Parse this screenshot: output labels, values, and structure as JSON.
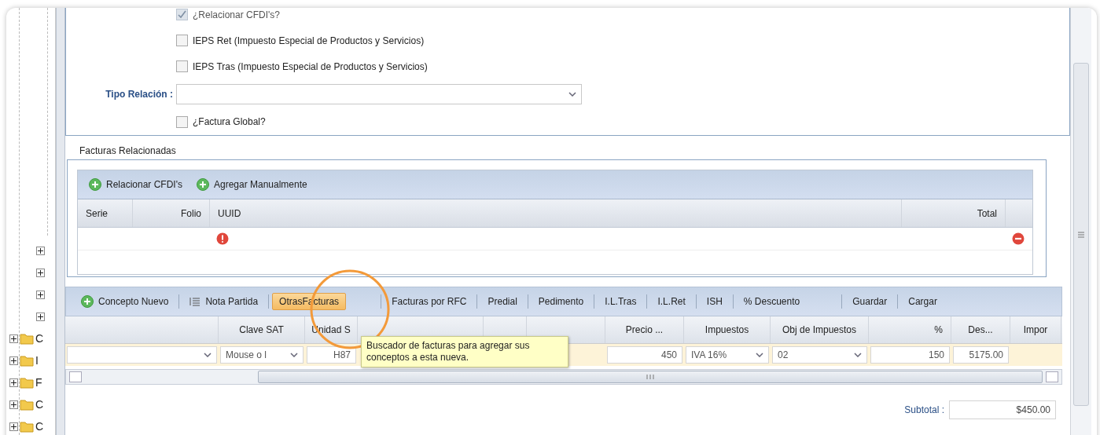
{
  "tree": {
    "items": [
      {
        "expanded": false
      },
      {
        "expanded": false
      },
      {
        "expanded": false
      },
      {
        "expanded": false
      },
      {
        "expanded": false,
        "label": "C"
      },
      {
        "expanded": false,
        "label": "I"
      },
      {
        "expanded": false,
        "label": "F"
      },
      {
        "expanded": false,
        "label": "C"
      },
      {
        "expanded": false,
        "label": "C"
      }
    ]
  },
  "form": {
    "checkboxes": [
      {
        "label": "¿Relacionar CFDI's?",
        "checked": true,
        "disabled": true
      },
      {
        "label": "IEPS Ret (Impuesto Especial de Productos y Servicios)",
        "checked": false,
        "disabled": false
      },
      {
        "label": "IEPS Tras (Impuesto Especial de Productos y Servicios)",
        "checked": false,
        "disabled": false
      }
    ],
    "tipo_relacion": {
      "label": "Tipo Relación :"
    },
    "factura_global": {
      "label": "¿Factura Global?",
      "checked": false,
      "disabled": false
    }
  },
  "related_invoices": {
    "title": "Facturas Relacionadas",
    "actions": [
      "Relacionar CFDI's",
      "Agregar Manualmente"
    ],
    "columns": [
      "Serie",
      "Folio",
      "UUID",
      "Total"
    ]
  },
  "concepts": {
    "toolbar": [
      {
        "label": "Concepto Nuevo",
        "kind": "add",
        "selected": false
      },
      {
        "label": "Nota Partida",
        "kind": "list",
        "selected": false
      },
      {
        "label": "OtrasFacturas",
        "kind": "text",
        "selected": true
      },
      {
        "label": "Facturas por RFC",
        "kind": "text",
        "selected": false
      },
      {
        "label": "Predial",
        "kind": "text",
        "selected": false
      },
      {
        "label": "Pedimento",
        "kind": "text",
        "selected": false
      },
      {
        "label": "I.L.Tras",
        "kind": "text",
        "selected": false
      },
      {
        "label": "I.L.Ret",
        "kind": "text",
        "selected": false
      },
      {
        "label": "ISH",
        "kind": "text",
        "selected": false
      },
      {
        "label": "% Descuento",
        "kind": "text",
        "selected": false
      },
      {
        "label": "Guardar",
        "kind": "text",
        "selected": false
      },
      {
        "label": "Cargar",
        "kind": "text",
        "selected": false
      }
    ],
    "columns": [
      {},
      {
        "label": "Clave SAT"
      },
      {
        "label": "Unidad S"
      },
      {},
      {},
      {},
      {
        "label": "Precio ..."
      },
      {
        "label": "Impuestos"
      },
      {
        "label": "Obj de Impuestos"
      },
      {
        "label": "%"
      },
      {
        "label": "Des..."
      },
      {
        "label": "Impor"
      }
    ],
    "row": [
      {
        "kind": "select"
      },
      {
        "kind": "select",
        "value": "Mouse o l"
      },
      {
        "kind": "input",
        "value": "H87"
      },
      {
        "kind": "blank"
      },
      {
        "kind": "blank"
      },
      {
        "kind": "blank"
      },
      {
        "kind": "input",
        "value": "450"
      },
      {
        "kind": "select",
        "value": "IVA 16%"
      },
      {
        "kind": "select",
        "value": "02"
      },
      {
        "kind": "input",
        "value": "150"
      },
      {
        "kind": "input",
        "value": "5175.00"
      },
      {
        "kind": "blank"
      }
    ],
    "tooltip": "Buscador de facturas para agregar sus conceptos a esta nueva."
  },
  "totals": {
    "subtotal_label": "Subtotal :",
    "subtotal": "$450.00"
  }
}
